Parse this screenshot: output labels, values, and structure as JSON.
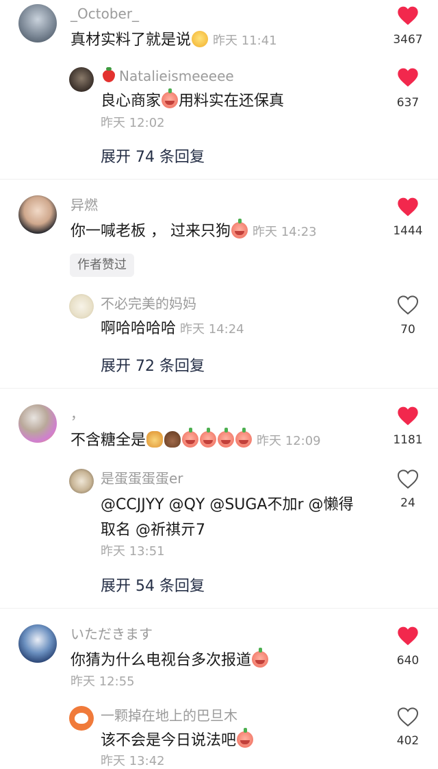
{
  "comments": [
    {
      "username": "_October_",
      "text": "真材实料了就是说",
      "emojis": [
        "yellow-face"
      ],
      "time": "昨天 11:41",
      "likes": "3467",
      "liked": true,
      "reply": {
        "username": "Natalieismeeeee",
        "username_emoji": "strawberry",
        "text": "良心商家",
        "emoji_mid": "crying-face",
        "text2": "用料实在还保真",
        "time": "昨天 12:02",
        "likes": "637",
        "liked": true
      },
      "expand": "展开 74 条回复"
    },
    {
      "username": "异燃",
      "text": "你一喊老板 ， 过来只狗",
      "emojis": [
        "crying-face"
      ],
      "time": "昨天 14:23",
      "likes": "1444",
      "liked": true,
      "badge": "作者赞过",
      "reply": {
        "username": "不必完美的妈妈",
        "text": "啊哈哈哈哈",
        "time": "昨天 14:24",
        "likes": "70",
        "liked": false
      },
      "expand": "展开 72 条回复"
    },
    {
      "username": "，",
      "text": "不含糖全是",
      "emojis": [
        "dog-face",
        "poop",
        "crying-face",
        "crying-face",
        "crying-face",
        "crying-face"
      ],
      "time": "昨天 12:09",
      "likes": "1181",
      "liked": true,
      "reply": {
        "username": "是蛋蛋蛋蛋er",
        "text_line1": "@CCJJYY @QY @SUGA不加r @懒得",
        "text_line2": "取名 @祈祺亓7",
        "time": "昨天 13:51",
        "likes": "24",
        "liked": false
      },
      "expand": "展开 54 条回复"
    },
    {
      "username": "いただきます",
      "text": "你猜为什么电视台多次报道",
      "emojis": [
        "crying-face"
      ],
      "time": "昨天 12:55",
      "likes": "640",
      "liked": true,
      "reply": {
        "username": "一颗掉在地上的巴旦木",
        "text": "该不会是今日说法吧",
        "emojis": [
          "crying-face"
        ],
        "time": "昨天 13:42",
        "likes": "402",
        "liked": false
      }
    }
  ],
  "colors": {
    "liked_heart": "#f2284d",
    "link_text": "#252f46",
    "muted_text": "#9b9b9b"
  }
}
